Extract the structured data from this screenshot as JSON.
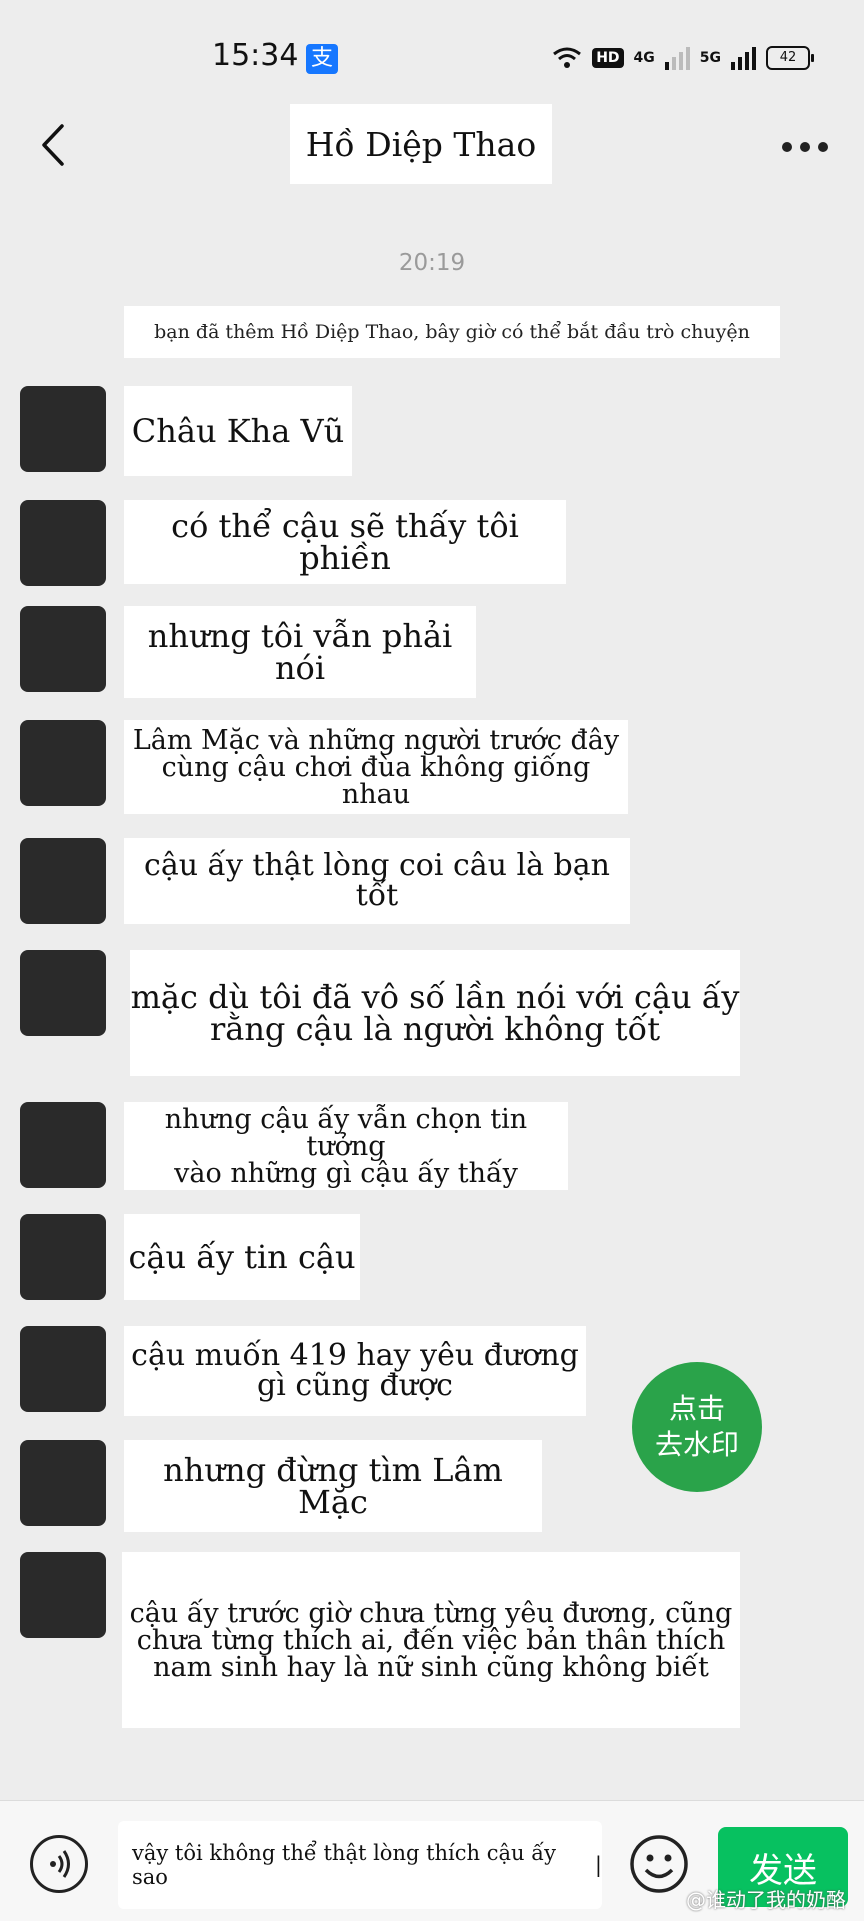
{
  "status": {
    "time": "15:34",
    "app_icon": "支",
    "hd": "HD",
    "net1": "4G",
    "net2": "5G",
    "battery": "42"
  },
  "header": {
    "title": "Hồ Diệp Thao",
    "back_icon": "chevron-left-icon",
    "more_icon": "more-dots-icon"
  },
  "chat": {
    "timestamp": "20:19",
    "system_note": "bạn đã thêm Hồ Diệp Thao, bây giờ có thể bắt đầu trò chuyện",
    "messages": [
      {
        "lines": [
          "Châu Kha Vũ"
        ]
      },
      {
        "lines": [
          "có thể cậu sẽ thấy tôi phiền"
        ]
      },
      {
        "lines": [
          "nhưng tôi vẫn phải nói"
        ]
      },
      {
        "lines": [
          "Lâm Mặc và những người trước đây",
          "cùng cậu chơi đùa không giống nhau"
        ]
      },
      {
        "lines": [
          "cậu ấy thật lòng coi câu là bạn tốt"
        ]
      },
      {
        "lines": [
          "mặc dù tôi đã vô số lần nói với cậu ấy",
          "rằng cậu là người không tốt"
        ]
      },
      {
        "lines": [
          "nhưng cậu ấy vẫn chọn tin tưởng",
          "vào những gì cậu ấy thấy"
        ]
      },
      {
        "lines": [
          "cậu ấy tin cậu"
        ]
      },
      {
        "lines": [
          "cậu muốn 419 hay yêu đương",
          "gì cũng được"
        ]
      },
      {
        "lines": [
          "nhưng đừng tìm Lâm Mặc"
        ]
      },
      {
        "lines": [
          "cậu ấy trước giờ chưa từng yêu đương, cũng",
          "chưa từng thích ai, đến việc bản thân thích",
          "nam sinh hay là nữ sinh cũng không biết"
        ]
      }
    ]
  },
  "watermark_button": {
    "line1": "点击",
    "line2": "去水印"
  },
  "composer": {
    "input_value": "vậy tôi không thể thật lòng thích cậu ấy sao",
    "send_label": "发送",
    "voice_icon": "voice-icon",
    "emoji_icon": "emoji-icon"
  },
  "credit": "@谁动了我的奶酪"
}
